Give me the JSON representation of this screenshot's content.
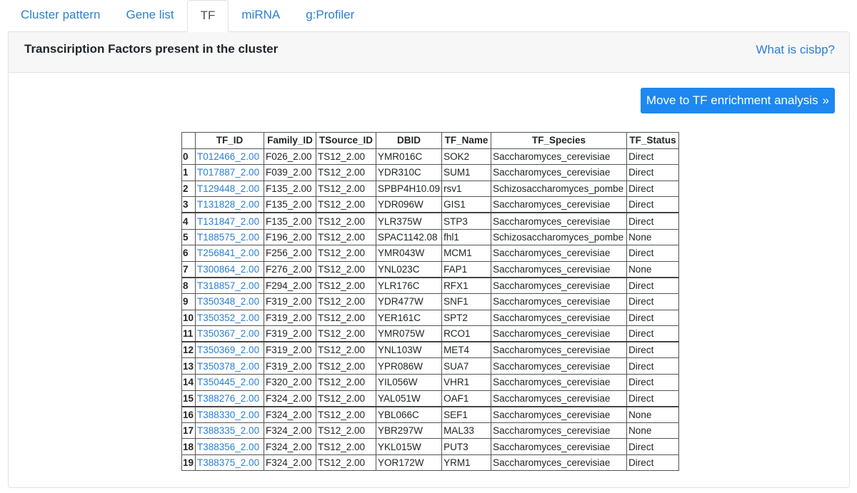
{
  "tabs": [
    {
      "label": "Cluster pattern",
      "active": false
    },
    {
      "label": "Gene list",
      "active": false
    },
    {
      "label": "TF",
      "active": true
    },
    {
      "label": "miRNA",
      "active": false
    },
    {
      "label": "g:Profiler",
      "active": false
    }
  ],
  "card": {
    "title": "Transciription Factors present in the cluster",
    "help_link": "What is cisbp?",
    "move_button_label": "Move to TF enrichment analysis",
    "move_button_icon": "»"
  },
  "table": {
    "columns": [
      "",
      "TF_ID",
      "Family_ID",
      "TSource_ID",
      "DBID",
      "TF_Name",
      "TF_Species",
      "TF_Status"
    ],
    "rows": [
      [
        "0",
        "T012466_2.00",
        "F026_2.00",
        "TS12_2.00",
        "YMR016C",
        "SOK2",
        "Saccharomyces_cerevisiae",
        "Direct"
      ],
      [
        "1",
        "T017887_2.00",
        "F039_2.00",
        "TS12_2.00",
        "YDR310C",
        "SUM1",
        "Saccharomyces_cerevisiae",
        "Direct"
      ],
      [
        "2",
        "T129448_2.00",
        "F135_2.00",
        "TS12_2.00",
        "SPBP4H10.09",
        "rsv1",
        "Schizosaccharomyces_pombe",
        "Direct"
      ],
      [
        "3",
        "T131828_2.00",
        "F135_2.00",
        "TS12_2.00",
        "YDR096W",
        "GIS1",
        "Saccharomyces_cerevisiae",
        "Direct"
      ],
      [
        "4",
        "T131847_2.00",
        "F135_2.00",
        "TS12_2.00",
        "YLR375W",
        "STP3",
        "Saccharomyces_cerevisiae",
        "Direct"
      ],
      [
        "5",
        "T188575_2.00",
        "F196_2.00",
        "TS12_2.00",
        "SPAC1142.08",
        "fhl1",
        "Schizosaccharomyces_pombe",
        "None"
      ],
      [
        "6",
        "T256841_2.00",
        "F256_2.00",
        "TS12_2.00",
        "YMR043W",
        "MCM1",
        "Saccharomyces_cerevisiae",
        "Direct"
      ],
      [
        "7",
        "T300864_2.00",
        "F276_2.00",
        "TS12_2.00",
        "YNL023C",
        "FAP1",
        "Saccharomyces_cerevisiae",
        "None"
      ],
      [
        "8",
        "T318857_2.00",
        "F294_2.00",
        "TS12_2.00",
        "YLR176C",
        "RFX1",
        "Saccharomyces_cerevisiae",
        "Direct"
      ],
      [
        "9",
        "T350348_2.00",
        "F319_2.00",
        "TS12_2.00",
        "YDR477W",
        "SNF1",
        "Saccharomyces_cerevisiae",
        "Direct"
      ],
      [
        "10",
        "T350352_2.00",
        "F319_2.00",
        "TS12_2.00",
        "YER161C",
        "SPT2",
        "Saccharomyces_cerevisiae",
        "Direct"
      ],
      [
        "11",
        "T350367_2.00",
        "F319_2.00",
        "TS12_2.00",
        "YMR075W",
        "RCO1",
        "Saccharomyces_cerevisiae",
        "Direct"
      ],
      [
        "12",
        "T350369_2.00",
        "F319_2.00",
        "TS12_2.00",
        "YNL103W",
        "MET4",
        "Saccharomyces_cerevisiae",
        "Direct"
      ],
      [
        "13",
        "T350378_2.00",
        "F319_2.00",
        "TS12_2.00",
        "YPR086W",
        "SUA7",
        "Saccharomyces_cerevisiae",
        "Direct"
      ],
      [
        "14",
        "T350445_2.00",
        "F320_2.00",
        "TS12_2.00",
        "YIL056W",
        "VHR1",
        "Saccharomyces_cerevisiae",
        "Direct"
      ],
      [
        "15",
        "T388276_2.00",
        "F324_2.00",
        "TS12_2.00",
        "YAL051W",
        "OAF1",
        "Saccharomyces_cerevisiae",
        "Direct"
      ],
      [
        "16",
        "T388330_2.00",
        "F324_2.00",
        "TS12_2.00",
        "YBL066C",
        "SEF1",
        "Saccharomyces_cerevisiae",
        "None"
      ],
      [
        "17",
        "T388335_2.00",
        "F324_2.00",
        "TS12_2.00",
        "YBR297W",
        "MAL33",
        "Saccharomyces_cerevisiae",
        "None"
      ],
      [
        "18",
        "T388356_2.00",
        "F324_2.00",
        "TS12_2.00",
        "YKL015W",
        "PUT3",
        "Saccharomyces_cerevisiae",
        "Direct"
      ],
      [
        "19",
        "T388375_2.00",
        "F324_2.00",
        "TS12_2.00",
        "YOR172W",
        "YRM1",
        "Saccharomyces_cerevisiae",
        "Direct"
      ]
    ]
  }
}
